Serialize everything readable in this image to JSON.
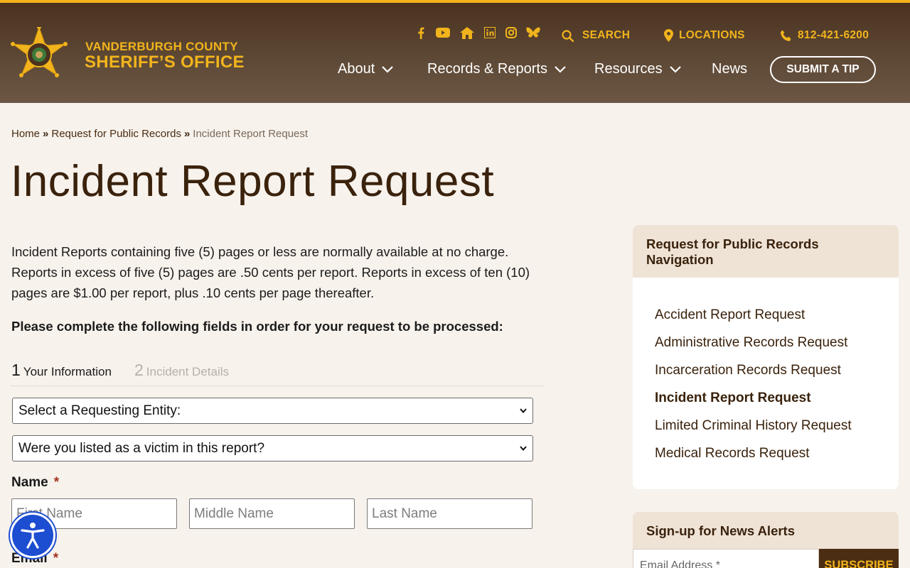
{
  "brand": {
    "line1": "VANDERBURGH COUNTY",
    "line2": "SHERIFF’S OFFICE",
    "logo_icon": "sheriff-star-badge-icon",
    "accent": "#f2b41c"
  },
  "social": [
    "facebook-icon",
    "youtube-icon",
    "home-icon",
    "linkedin-icon",
    "instagram-icon",
    "bluesky-butterfly-icon"
  ],
  "utility": {
    "search": "SEARCH",
    "locations": "LOCATIONS",
    "phone": "812-421-6200"
  },
  "nav": {
    "about": "About",
    "records": "Records & Reports",
    "resources": "Resources",
    "news": "News",
    "tip": "SUBMIT A TIP"
  },
  "breadcrumb": {
    "home": "Home",
    "sep": "»",
    "parent": "Request for Public Records",
    "current": "Incident Report Request"
  },
  "page": {
    "title": "Incident Report Request",
    "intro": "Incident Reports containing five (5) pages or less are normally available at no charge. Reports in excess of five (5) pages are .50 cents per report. Reports in excess of ten (10) pages are $1.00 per report, plus .10 cents per page thereafter.",
    "instruction": "Please complete the following fields in order for your request to be processed:"
  },
  "form": {
    "steps": [
      {
        "num": "1",
        "label": "Your Information"
      },
      {
        "num": "2",
        "label": "Incident Details"
      }
    ],
    "entity_select": "Select a Requesting Entity:",
    "victim_select": "Were you listed as a victim in this report?",
    "name_label": "Name",
    "required_mark": "*",
    "first_placeholder": "First Name",
    "middle_placeholder": "Middle Name",
    "last_placeholder": "Last Name",
    "email_label": "Email"
  },
  "sidebar": {
    "title": "Request for Public Records Navigation",
    "items": [
      "Accident Report Request",
      "Administrative Records Request",
      "Incarceration Records Request",
      "Incident Report Request",
      "Limited Criminal History Request",
      "Medical Records Request"
    ],
    "active_index": 3
  },
  "news_alerts": {
    "title": "Sign-up for News Alerts",
    "placeholder": "Email Address *",
    "button": "SUBSCRIBE"
  }
}
